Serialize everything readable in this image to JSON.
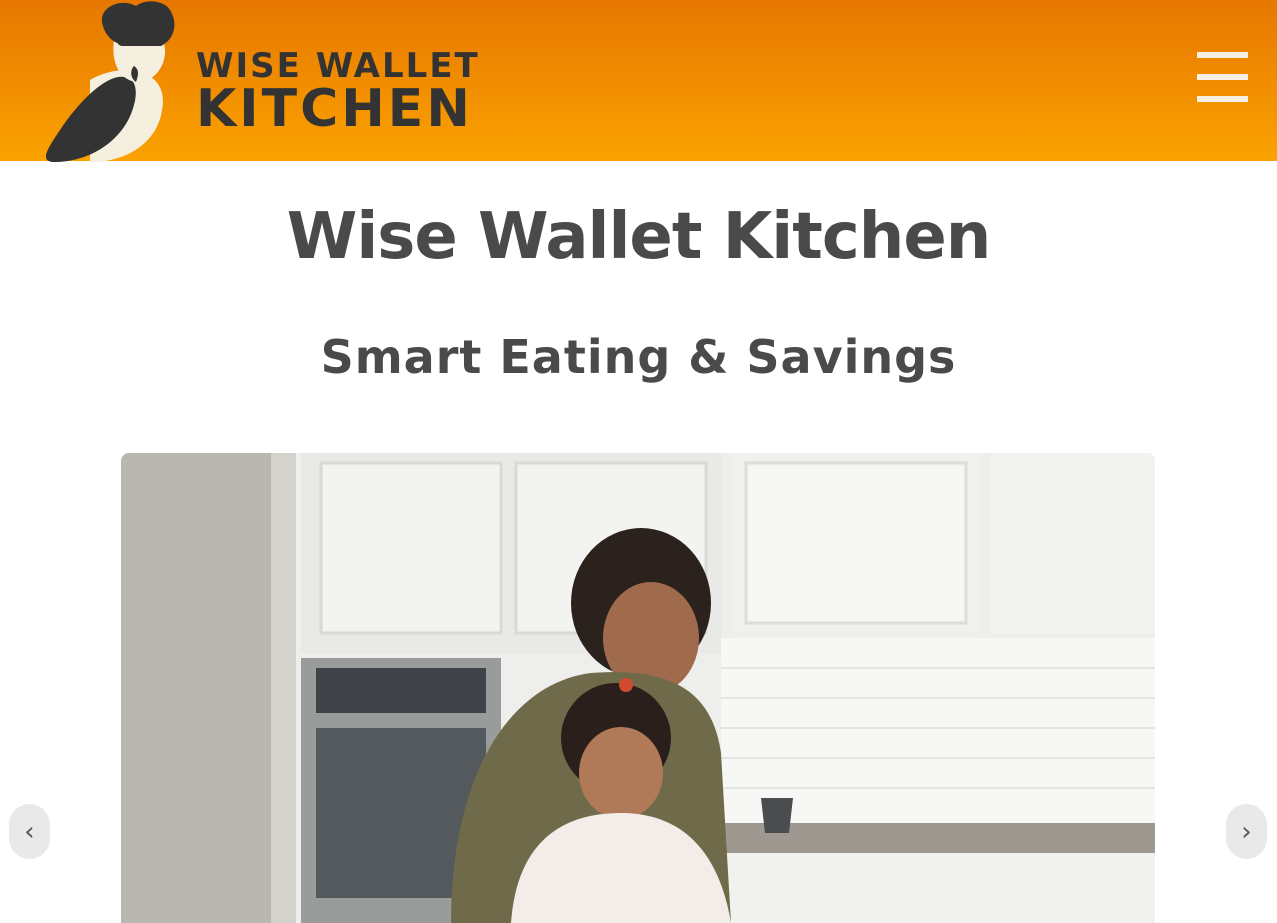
{
  "header": {
    "logo": {
      "line1": "WISE WALLET",
      "line2": "KITCHEN",
      "icon": "chef-bird-logo"
    },
    "menu_icon": "hamburger-menu-icon"
  },
  "hero": {
    "title": "Wise Wallet Kitchen",
    "subtitle": "Smart Eating & Savings"
  },
  "carousel": {
    "prev_label": "‹",
    "next_label": "›",
    "slide_image": "mother and daughter cooking in a kitchen"
  },
  "colors": {
    "header_top": "#e67700",
    "header_bottom": "#fba200",
    "title_text": "#4a4a4a",
    "logo_dark": "#333333"
  }
}
